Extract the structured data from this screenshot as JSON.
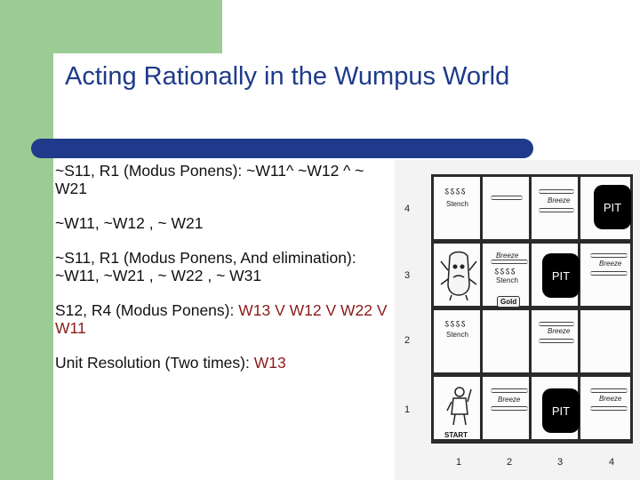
{
  "slide": {
    "title": "Acting Rationally in the Wumpus World",
    "paragraphs": [
      {
        "plain": "~S11, R1 (Modus Ponens): ~W11^ ~W12 ^ ~ W21",
        "highlight": ""
      },
      {
        "plain": "~W11,  ~W12 , ~ W21",
        "highlight": ""
      },
      {
        "plain": "~S11, R1 (Modus Ponens, And elimination): ~W11, ~W21 , ~ W22 , ~ W31",
        "highlight": ""
      },
      {
        "plain": "S12, R4 (Modus Ponens): ",
        "highlight": "W13 V W12 V W22 V W11"
      },
      {
        "plain": "Unit Resolution (Two times): ",
        "highlight": "W13"
      }
    ],
    "colors": {
      "accent": "#1f3a8a",
      "sidebar": "#9ccc96",
      "highlight": "#8b1a1a"
    }
  },
  "wumpus_figure": {
    "row_labels": [
      "4",
      "3",
      "2",
      "1"
    ],
    "col_labels": [
      "1",
      "2",
      "3",
      "4"
    ],
    "pit_label": "PIT",
    "stench_label": "Stench",
    "breeze_label": "Breeze",
    "gold_label": "Gold",
    "start_label": "START",
    "icons": [
      "wumpus-icon",
      "agent-icon"
    ]
  }
}
